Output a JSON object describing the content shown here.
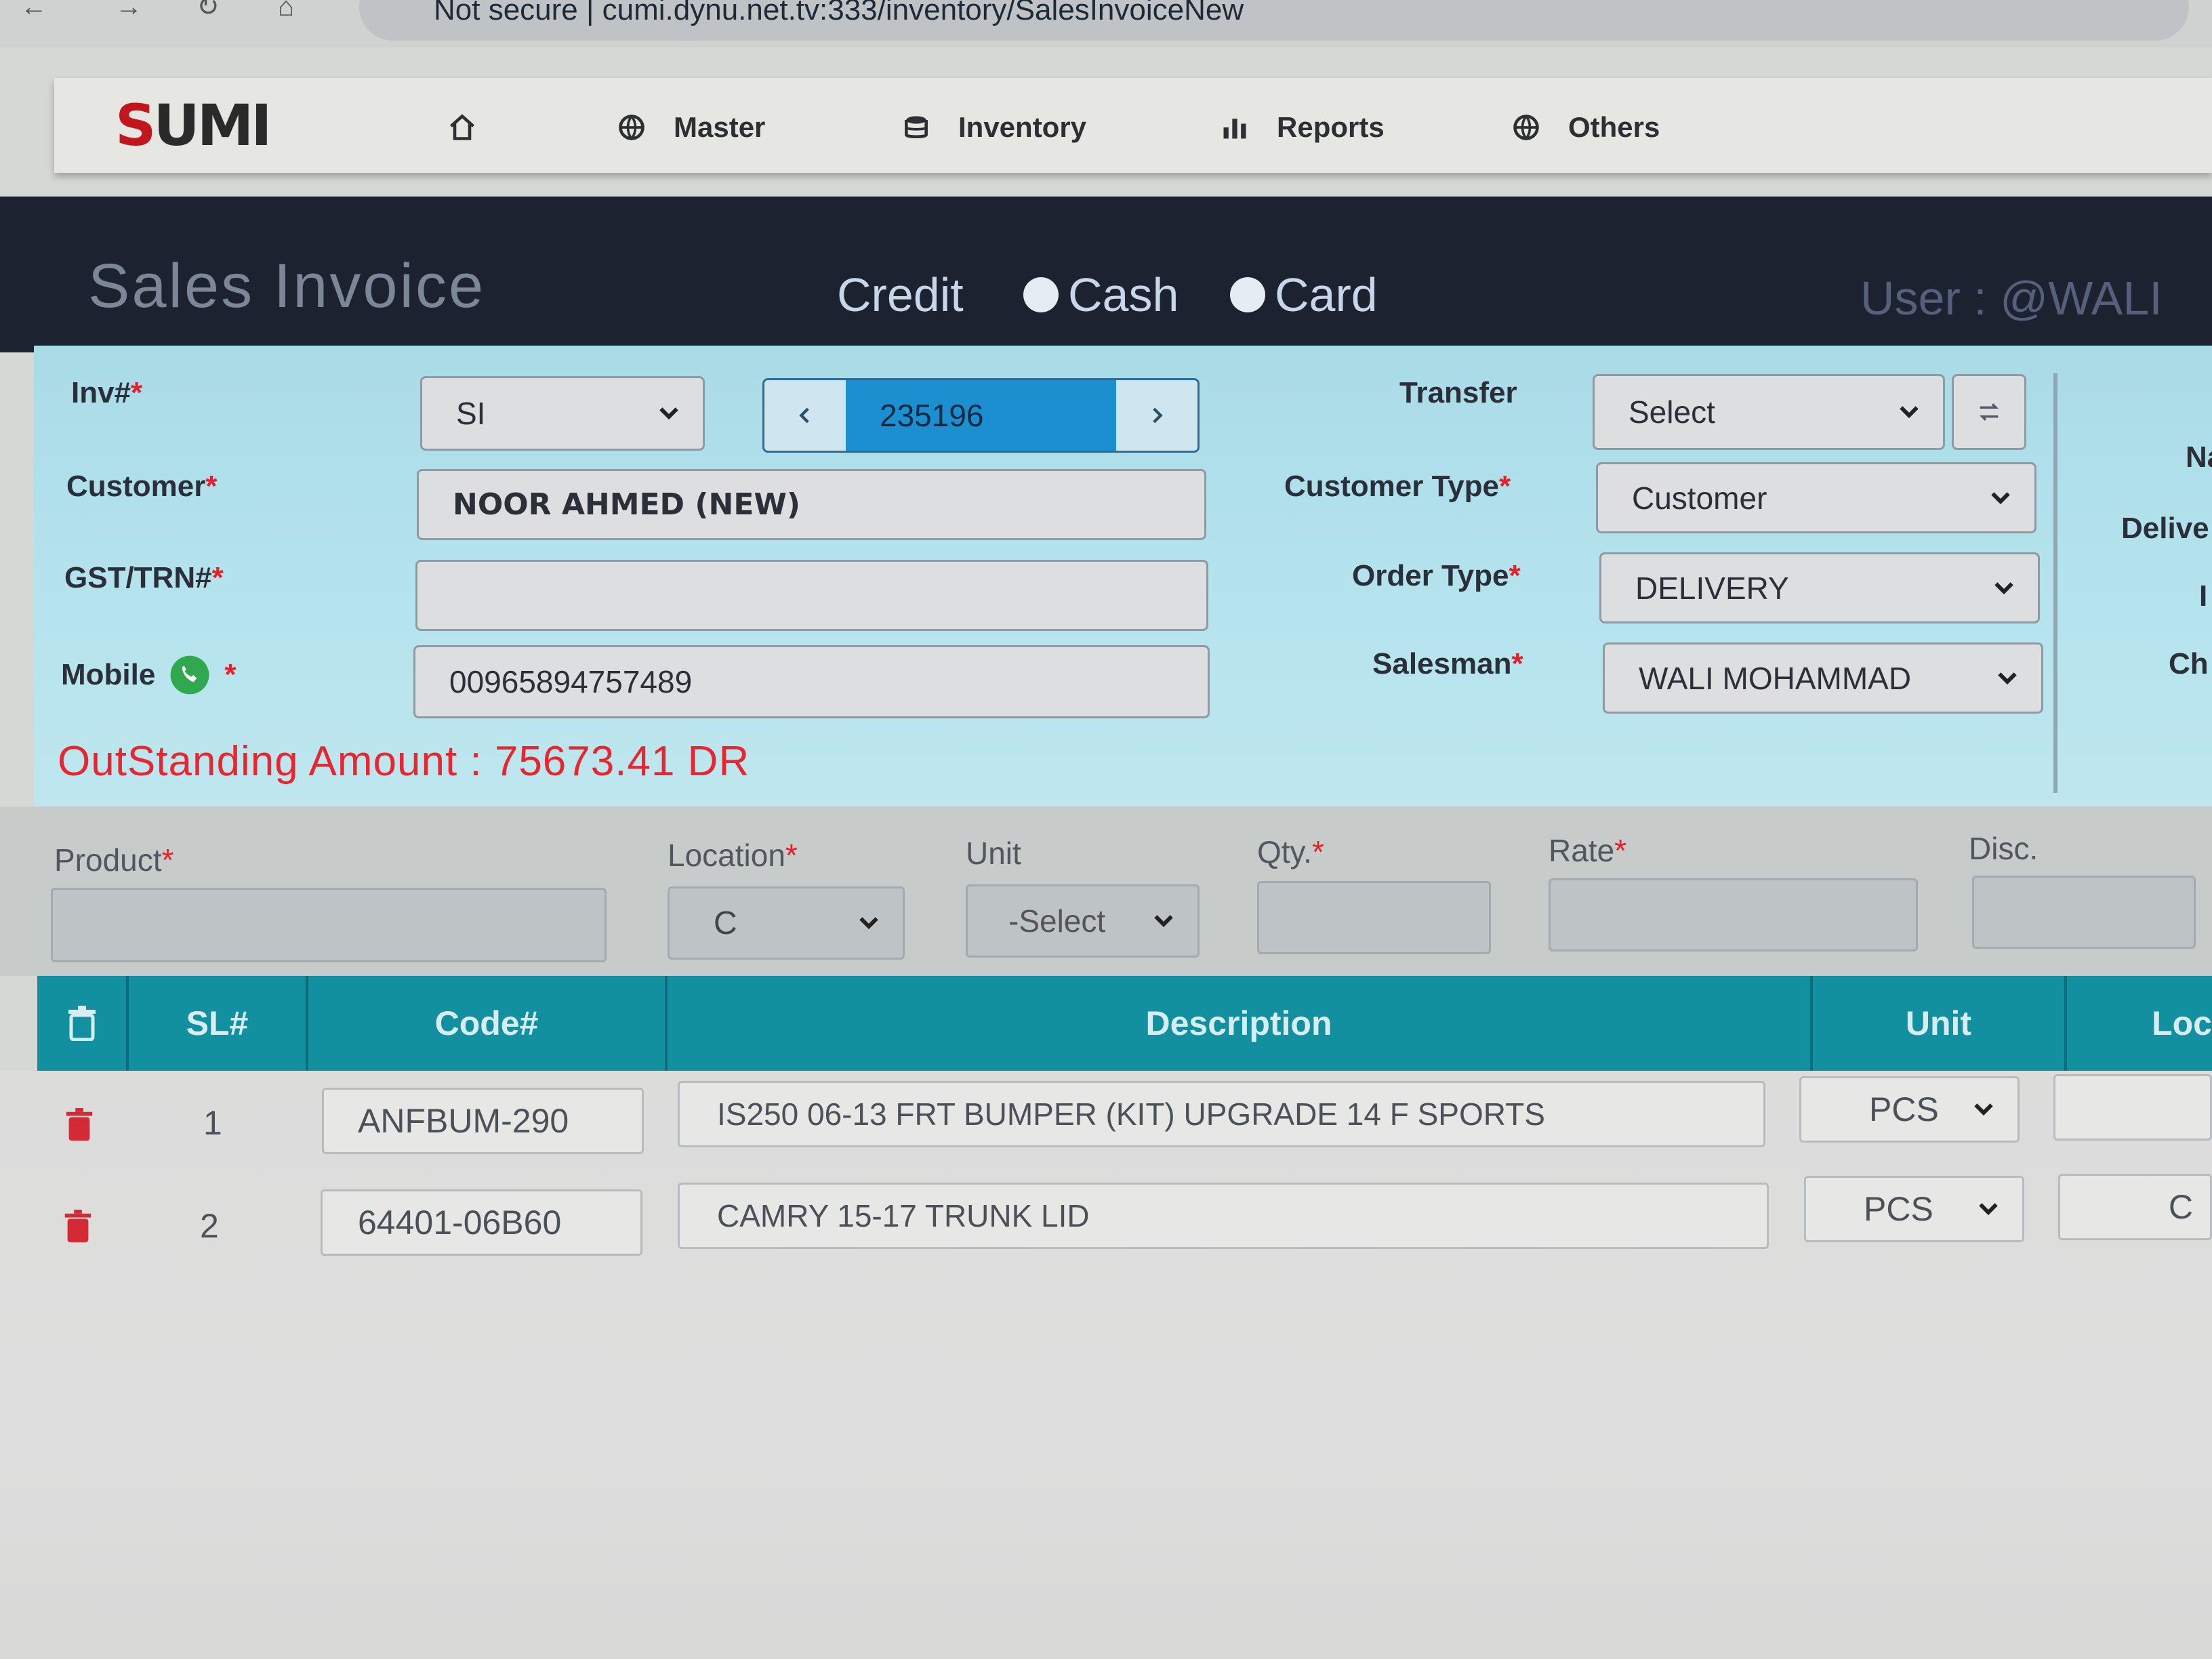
{
  "browser": {
    "url_text": "Not secure | cumi.dynu.net.tv:333/inventory/SalesInvoiceNew"
  },
  "nav": {
    "logo_text": "SUMI",
    "items": [
      {
        "label": "",
        "icon": "home-icon"
      },
      {
        "label": "Master",
        "icon": "globe-icon"
      },
      {
        "label": "Inventory",
        "icon": "database-icon"
      },
      {
        "label": "Reports",
        "icon": "bar-chart-icon"
      },
      {
        "label": "Others",
        "icon": "globe-icon"
      }
    ]
  },
  "header": {
    "title": "Sales Invoice",
    "payment_options": [
      "Credit",
      "Cash",
      "Card"
    ],
    "user": "User : @WALI"
  },
  "form": {
    "inv_label": "Inv#",
    "inv_series": "SI",
    "inv_number": "235196",
    "customer_label": "Customer",
    "customer_value": "NOOR AHMED (NEW)",
    "gst_label": "GST/TRN#",
    "gst_value": "",
    "mobile_label": "Mobile",
    "mobile_value": "00965894757489",
    "transfer_label": "Transfer",
    "transfer_value": "Select",
    "customer_type_label": "Customer Type",
    "customer_type_value": "Customer",
    "order_type_label": "Order Type",
    "order_type_value": "DELIVERY",
    "salesman_label": "Salesman",
    "salesman_value": "WALI MOHAMMAD",
    "right_labels": [
      "Na",
      "Delive",
      "I",
      "Ch"
    ],
    "outstanding": "OutStanding Amount : 75673.41 DR"
  },
  "entry": {
    "product_label": "Product",
    "location_label": "Location",
    "location_value": "C",
    "unit_label": "Unit",
    "unit_value": "-Select",
    "qty_label": "Qty.",
    "rate_label": "Rate",
    "disc_label": "Disc."
  },
  "grid": {
    "columns": [
      "SL#",
      "Code#",
      "Description",
      "Unit",
      "Loc"
    ],
    "rows": [
      {
        "sl": "1",
        "code": "ANFBUM-290",
        "description": "IS250 06-13  FRT  BUMPER (KIT)  UPGRADE 14 F SPORTS",
        "unit": "PCS",
        "loc": ""
      },
      {
        "sl": "2",
        "code": "64401-06B60",
        "description": "CAMRY 15-17  TRUNK LID",
        "unit": "PCS",
        "loc": "C"
      }
    ]
  },
  "colors": {
    "dark_band": "#1c2230",
    "panel": "#b6e4ee",
    "grid_header": "#12909f",
    "inv_number_bg": "#1b8fd0",
    "outstanding": "#e8262f",
    "trash": "#d42a35"
  }
}
